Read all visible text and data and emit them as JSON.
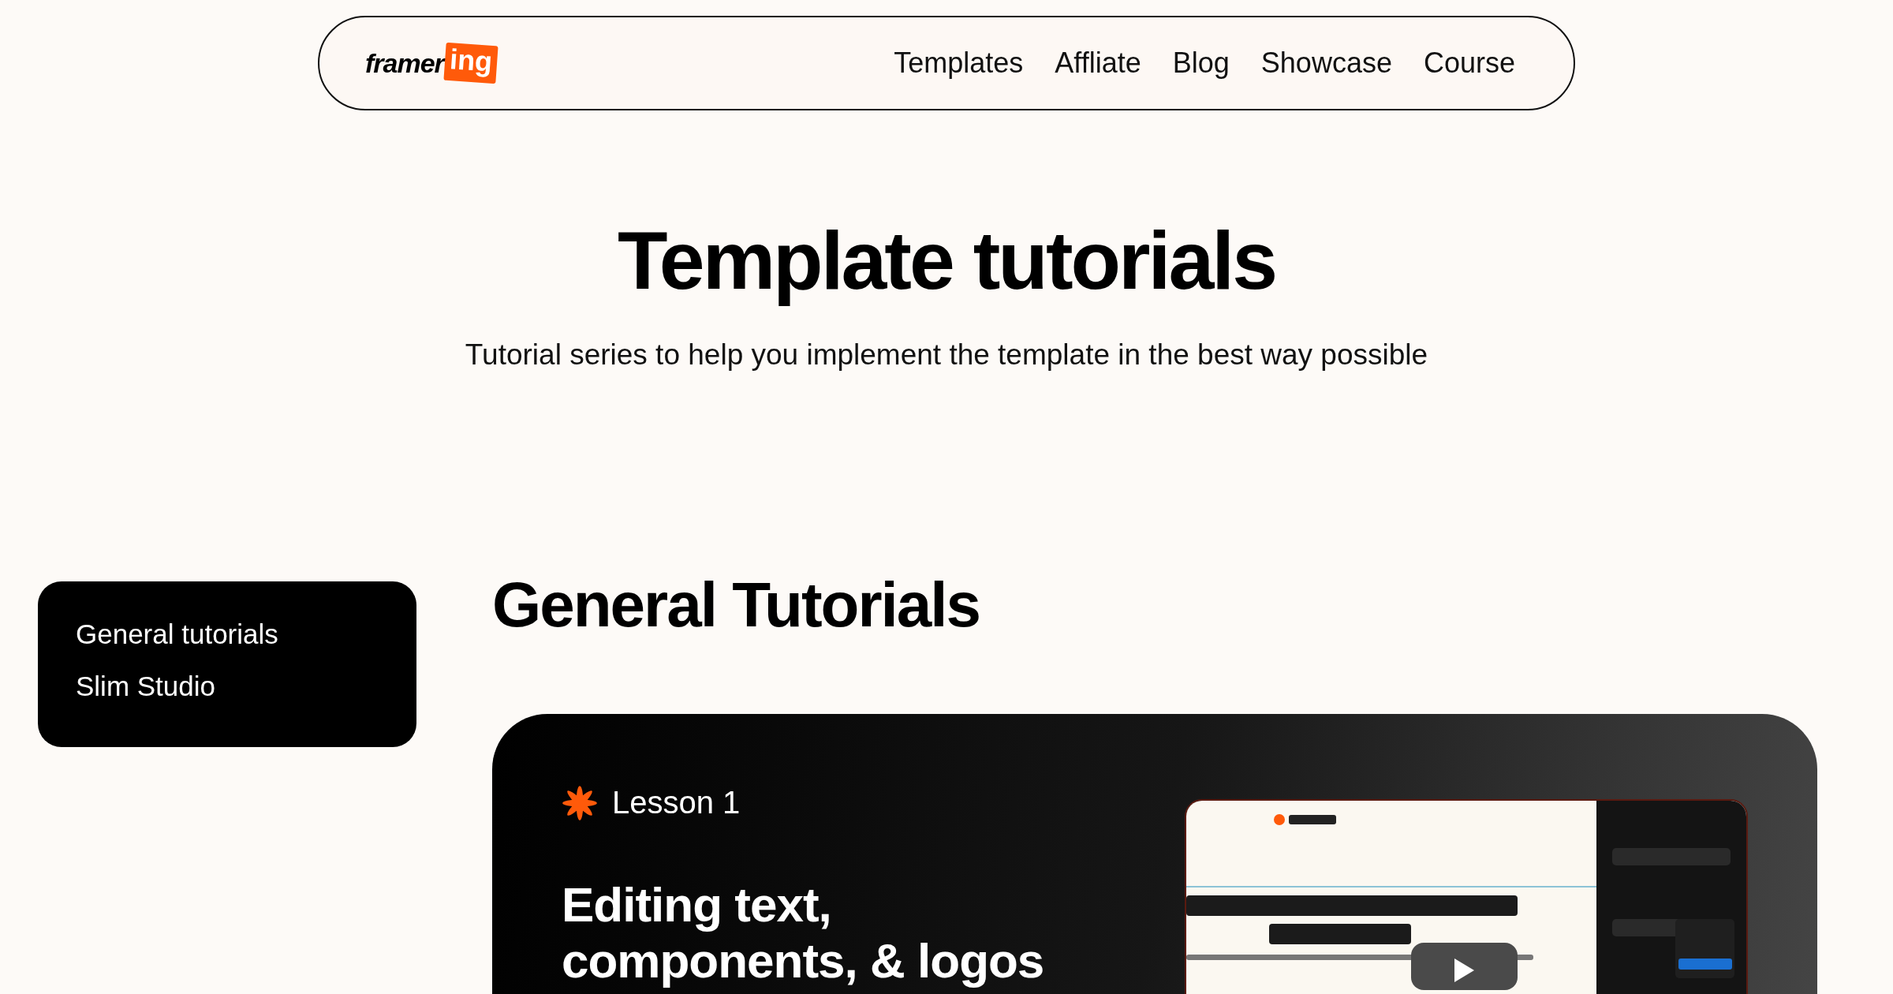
{
  "logo": {
    "text": "framer",
    "badge": "ing"
  },
  "nav": {
    "links": [
      "Templates",
      "Affliate",
      "Blog",
      "Showcase",
      "Course"
    ]
  },
  "hero": {
    "title": "Template tutorials",
    "subtitle": "Tutorial series to help you implement the template in the best way possible"
  },
  "sidebar": {
    "items": [
      "General tutorials",
      "Slim Studio"
    ]
  },
  "section": {
    "title": "General Tutorials"
  },
  "lessons": [
    {
      "label": "Lesson 1",
      "title": "Editing text, components, & logos"
    }
  ]
}
